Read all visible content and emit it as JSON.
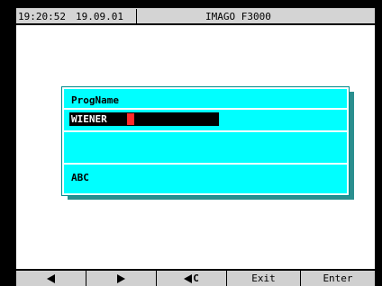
{
  "status_bar": {
    "time": "19:20:52",
    "date": "19.09.01",
    "title": "IMAGO F3000"
  },
  "dialog": {
    "title": "ProgName",
    "input_value": "WIENER",
    "mode_label": "ABC"
  },
  "function_keys": {
    "left_icon": "arrow-left-icon",
    "right_icon": "arrow-right-icon",
    "backspace_label": "C",
    "backspace_icon": "backspace-left-icon",
    "exit_label": "Exit",
    "enter_label": "Enter"
  },
  "colors": {
    "dialog_background": "#00ffff",
    "cursor": "#ff2a2a",
    "input_background": "#000000"
  }
}
